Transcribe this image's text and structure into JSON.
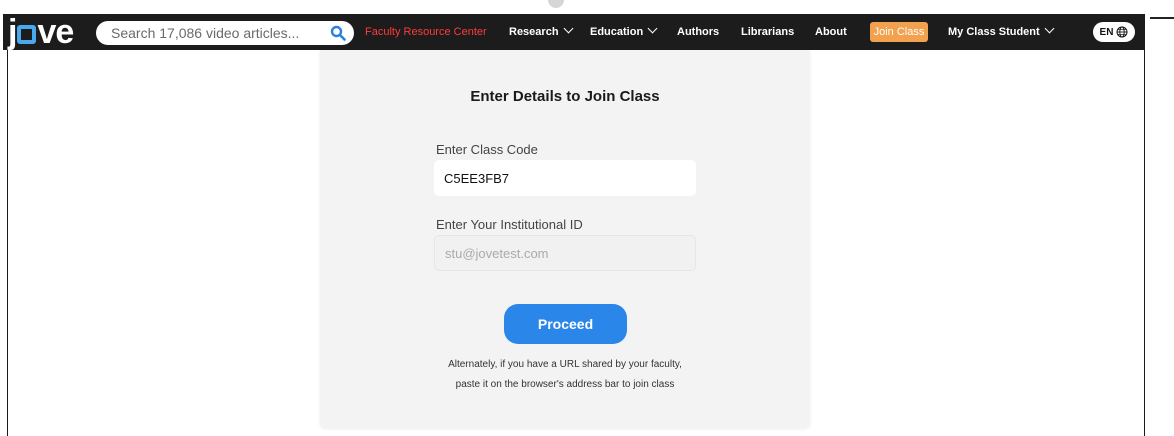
{
  "header": {
    "logo": {
      "left": "j",
      "right": "ve"
    },
    "search": {
      "placeholder": "Search 17,086 video articles..."
    },
    "nav": {
      "faculty": "Faculty Resource Center",
      "research": "Research",
      "education": "Education",
      "authors": "Authors",
      "librarians": "Librarians",
      "about": "About",
      "join_class": "Join Class",
      "user": "My Class Student",
      "lang": "EN"
    },
    "colors": {
      "bar": "#1c1c1c",
      "accent_blue": "#49a8ee",
      "faculty_red": "#ff3b3b",
      "join_orange": "#f2a14e"
    }
  },
  "form": {
    "title": "Enter Details to Join Class",
    "class_code_label": "Enter Class Code",
    "class_code_value": "C5EE3FB7",
    "inst_id_label": "Enter Your Institutional ID",
    "inst_id_placeholder": "stu@jovetest.com",
    "proceed_label": "Proceed",
    "note_line1": "Alternately, if you have a URL shared by your faculty,",
    "note_line2": "paste it on the browser's address bar to join class",
    "colors": {
      "card_bg": "#f3f3f3",
      "button": "#2a86e8"
    }
  }
}
